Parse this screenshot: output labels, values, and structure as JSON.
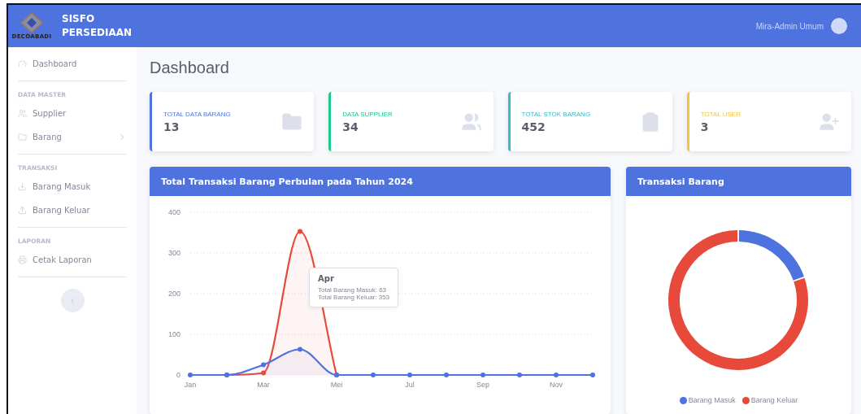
{
  "header": {
    "logo_text": "DECOABADI",
    "brand": "SISFO PERSEDIAAN",
    "user": "Mira-Admin Umum"
  },
  "sidebar": {
    "sections": [
      {
        "items": [
          {
            "label": "Dashboard"
          }
        ]
      },
      {
        "heading": "DATA MASTER",
        "items": [
          {
            "label": "Supplier"
          },
          {
            "label": "Barang",
            "expanded": false
          }
        ]
      },
      {
        "heading": "TRANSAKSI",
        "items": [
          {
            "label": "Barang Masuk"
          },
          {
            "label": "Barang Keluar"
          }
        ]
      },
      {
        "heading": "LAPORAN",
        "items": [
          {
            "label": "Cetak Laporan"
          }
        ]
      }
    ]
  },
  "page_title": "Dashboard",
  "stat_cards": [
    {
      "title": "TOTAL DATA BARANG",
      "value": "13",
      "color": "#4e73df"
    },
    {
      "title": "DATA SUPPLIER",
      "value": "34",
      "color": "#1cc88a"
    },
    {
      "title": "TOTAL STOK BARANG",
      "value": "452",
      "color": "#36b9cc"
    },
    {
      "title": "TOTAL USER",
      "value": "3",
      "color": "#f6c23e"
    }
  ],
  "line_panel": {
    "title": "Total Transaksi Barang Perbulan pada Tahun 2024",
    "chart_data": {
      "type": "line",
      "categories": [
        "Jan",
        null,
        "Mar",
        null,
        "Mei",
        null,
        "Jul",
        null,
        "Sep",
        null,
        "Nov",
        null
      ],
      "ylim": [
        0,
        400
      ],
      "yticks": [
        0,
        100,
        200,
        300,
        400
      ],
      "grid": true,
      "series": [
        {
          "color": "#e74a3b",
          "marker": true,
          "values": [
            null,
            0,
            5,
            353,
            0,
            null,
            null,
            null,
            null,
            null,
            null,
            null
          ]
        },
        {
          "color": "#4e73df",
          "marker": true,
          "values": [
            0,
            0,
            25,
            63,
            0,
            0,
            0,
            0,
            0,
            0,
            0,
            0
          ]
        }
      ]
    },
    "tooltip": {
      "title": "Apr",
      "lines": [
        "Total Barang Masuk: 63",
        "Total Barang Keluar: 353"
      ]
    }
  },
  "donut_panel": {
    "title": "Transaksi Barang",
    "chart_data": {
      "type": "donut",
      "series": [
        {
          "values": [
            19.7,
            80.3
          ]
        }
      ]
    },
    "legend": [
      {
        "label": "Barang Masuk",
        "color": "#4e73df"
      },
      {
        "label": "Barang Keluar",
        "color": "#e74a3b"
      }
    ]
  }
}
